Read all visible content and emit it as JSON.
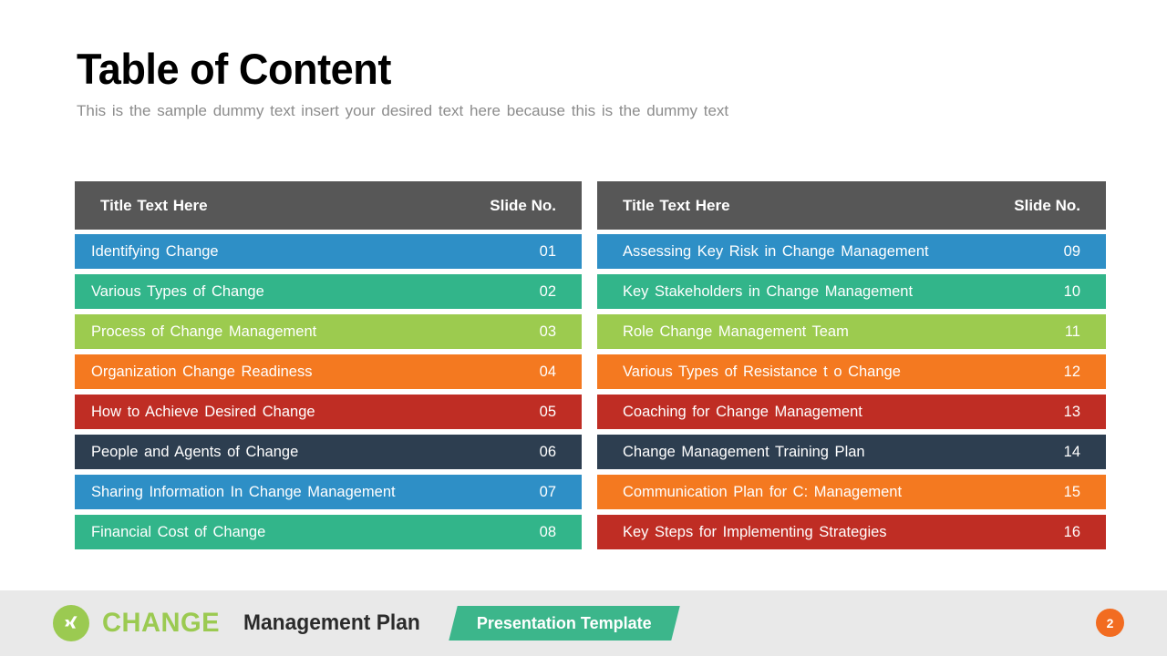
{
  "slide": {
    "title": "Table of Content",
    "subtitle": "This is the sample  dummy  text insert your desired text here because this is the dummy  text"
  },
  "tables": {
    "left": {
      "header": {
        "title": "Title Text Here",
        "number_label": "Slide No."
      },
      "rows": [
        {
          "label": "Identifying  Change",
          "num": "01",
          "color": "#2e8fc6"
        },
        {
          "label": "Various  Types  of Change",
          "num": "02",
          "color": "#32b58a"
        },
        {
          "label": "Process of Change  Management",
          "num": "03",
          "color": "#9ccb4f"
        },
        {
          "label": "Organization  Change  Readiness",
          "num": "04",
          "color": "#f47920"
        },
        {
          "label": "How to Achieve  Desired  Change",
          "num": "05",
          "color": "#bf2d24"
        },
        {
          "label": "People and Agents  of Change",
          "num": "06",
          "color": "#2d3e50"
        },
        {
          "label": "Sharing  Information  In Change  Management",
          "num": "07",
          "color": "#2e8fc6"
        },
        {
          "label": "Financial  Cost of Change",
          "num": "08",
          "color": "#32b58a"
        }
      ]
    },
    "right": {
      "header": {
        "title": "Title Text Here",
        "number_label": "Slide No."
      },
      "rows": [
        {
          "label": "Assessing  Key Risk in Change  Management",
          "num": "09",
          "color": "#2e8fc6"
        },
        {
          "label": "Key Stakeholders  in Change  Management",
          "num": "10",
          "color": "#32b58a"
        },
        {
          "label": "Role Change  Management  Team",
          "num": "11",
          "color": "#9ccb4f"
        },
        {
          "label": "Various Types of Resistance t o Change",
          "num": "12",
          "color": "#f47920"
        },
        {
          "label": "Coaching for Change  Management",
          "num": "13",
          "color": "#bf2d24"
        },
        {
          "label": "Change  Management  Training  Plan",
          "num": "14",
          "color": "#2d3e50"
        },
        {
          "label": "Communication  Plan  for C: Management",
          "num": "15",
          "color": "#f47920"
        },
        {
          "label": "Key Steps for Implementing  Strategies",
          "num": "16",
          "color": "#bf2d24"
        }
      ]
    }
  },
  "footer": {
    "logo_icon": "xing-x-icon",
    "brand_primary": "CHANGE",
    "brand_secondary": "Management Plan",
    "ribbon_label": "Presentation Template",
    "page_number": "2",
    "colors": {
      "band": "#e9e9e9",
      "brand_green": "#9bca51",
      "ribbon_green": "#3cb68b",
      "badge_orange": "#f26c21",
      "header_gray": "#575757"
    }
  }
}
